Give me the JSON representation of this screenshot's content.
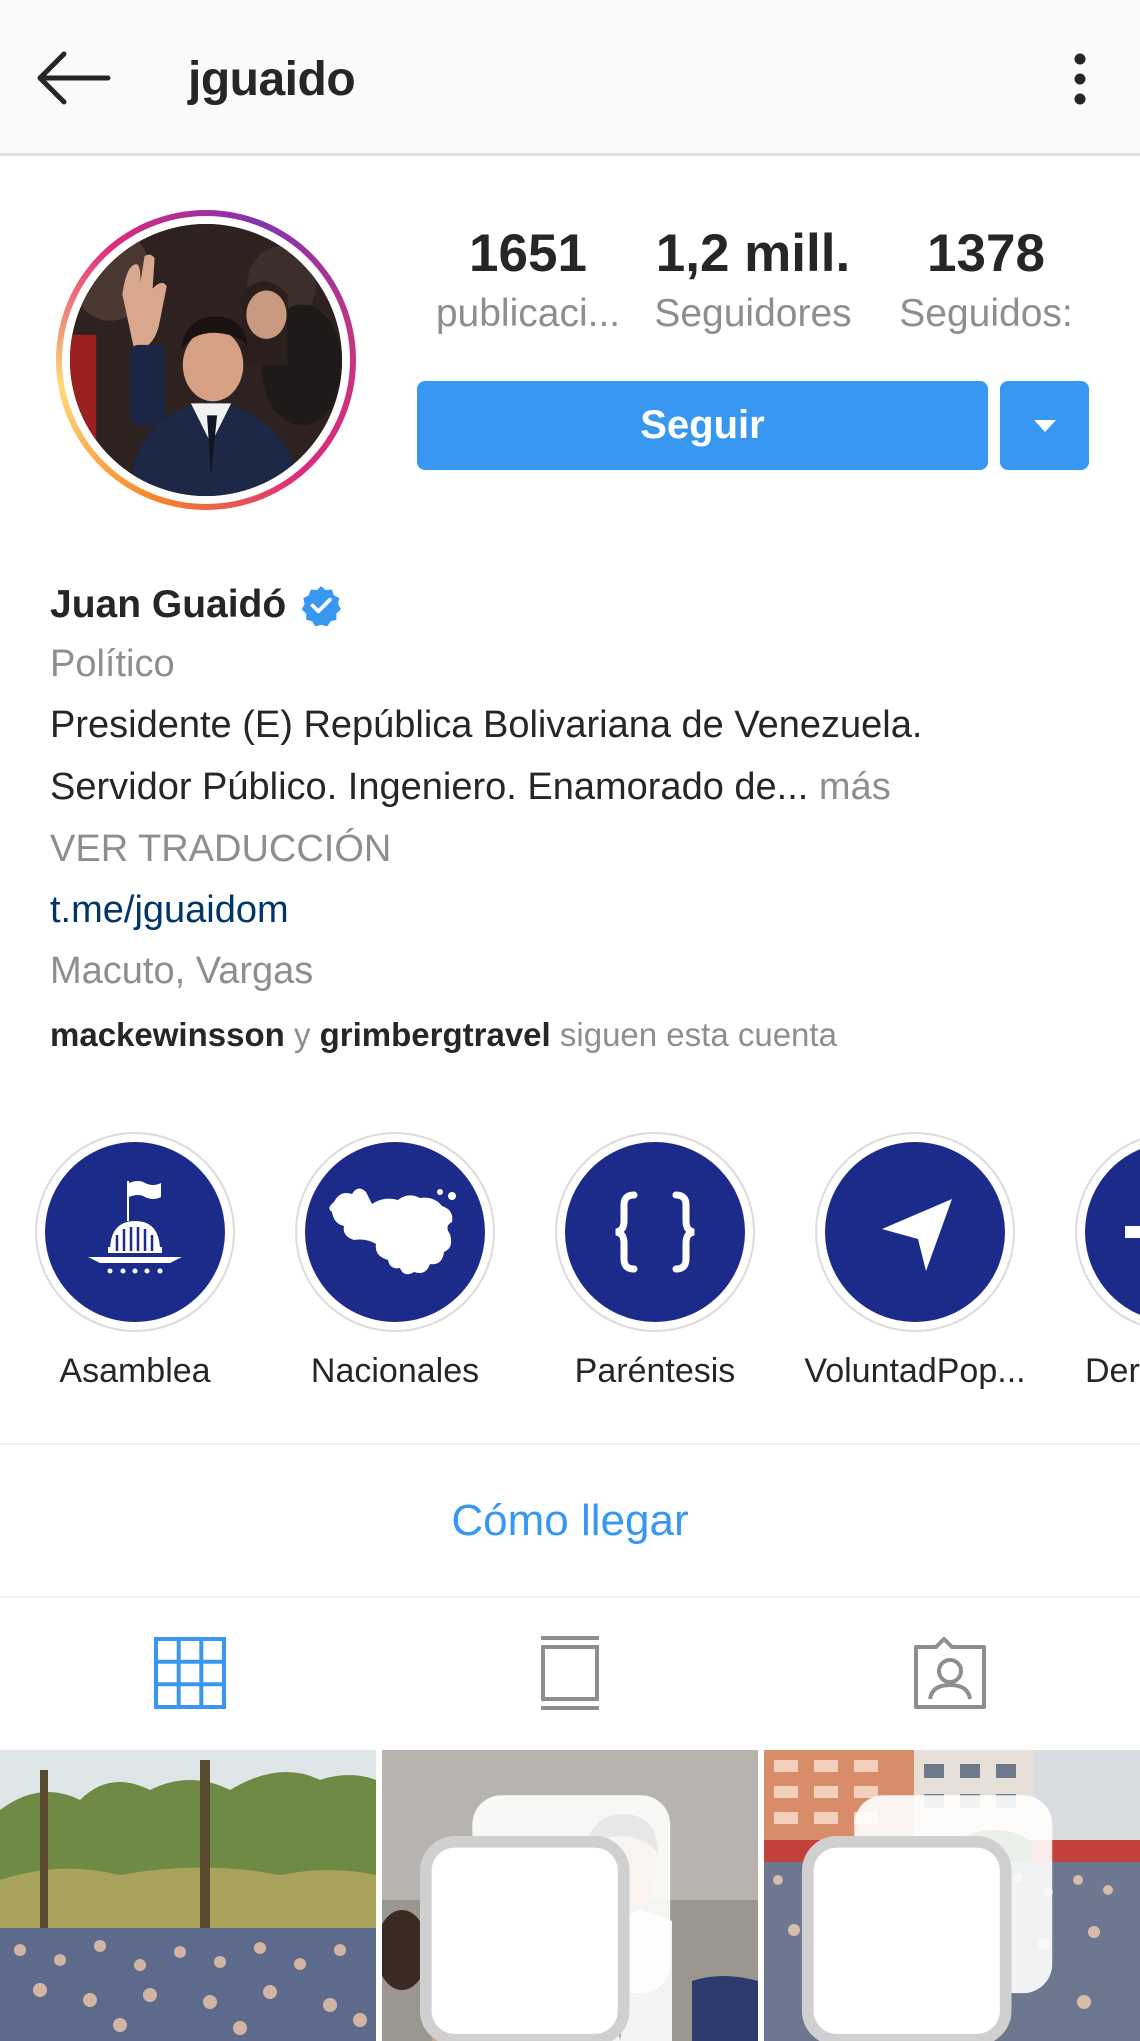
{
  "header": {
    "username": "jguaido"
  },
  "profile": {
    "stats": [
      {
        "value": "1651",
        "label": "publicaci..."
      },
      {
        "value": "1,2 mill.",
        "label": "Seguidores"
      },
      {
        "value": "1378",
        "label": "Seguidos:"
      }
    ],
    "follow_label": "Seguir",
    "accent_color": "#3897f0"
  },
  "bio": {
    "name": "Juan Guaidó",
    "category": "Político",
    "line1": "Presidente (E) República Bolivariana de Venezuela.",
    "line2": "Servidor Público. Ingeniero. Enamorado de...",
    "more": "más",
    "translate": "VER TRADUCCIÓN",
    "link": "t.me/jguaidom",
    "location": "Macuto, Vargas",
    "followed_by": {
      "user1": "mackewinsson",
      "conj": "y",
      "user2": "grimbergtravel",
      "suffix": "siguen esta cuenta"
    }
  },
  "highlights": [
    {
      "label": "Asamblea",
      "icon": "capitol-flag-icon"
    },
    {
      "label": "Nacionales",
      "icon": "venezuela-map-icon"
    },
    {
      "label": "Paréntesis",
      "icon": "braces-icon"
    },
    {
      "label": "VoluntadPop...",
      "icon": "paper-plane-icon"
    },
    {
      "label": "Der",
      "icon": "partial-icon"
    }
  ],
  "directions_label": "Cómo llegar",
  "tabs": [
    {
      "name": "grid-icon",
      "active": true
    },
    {
      "name": "feed-icon",
      "active": false
    },
    {
      "name": "tagged-icon",
      "active": false
    }
  ]
}
